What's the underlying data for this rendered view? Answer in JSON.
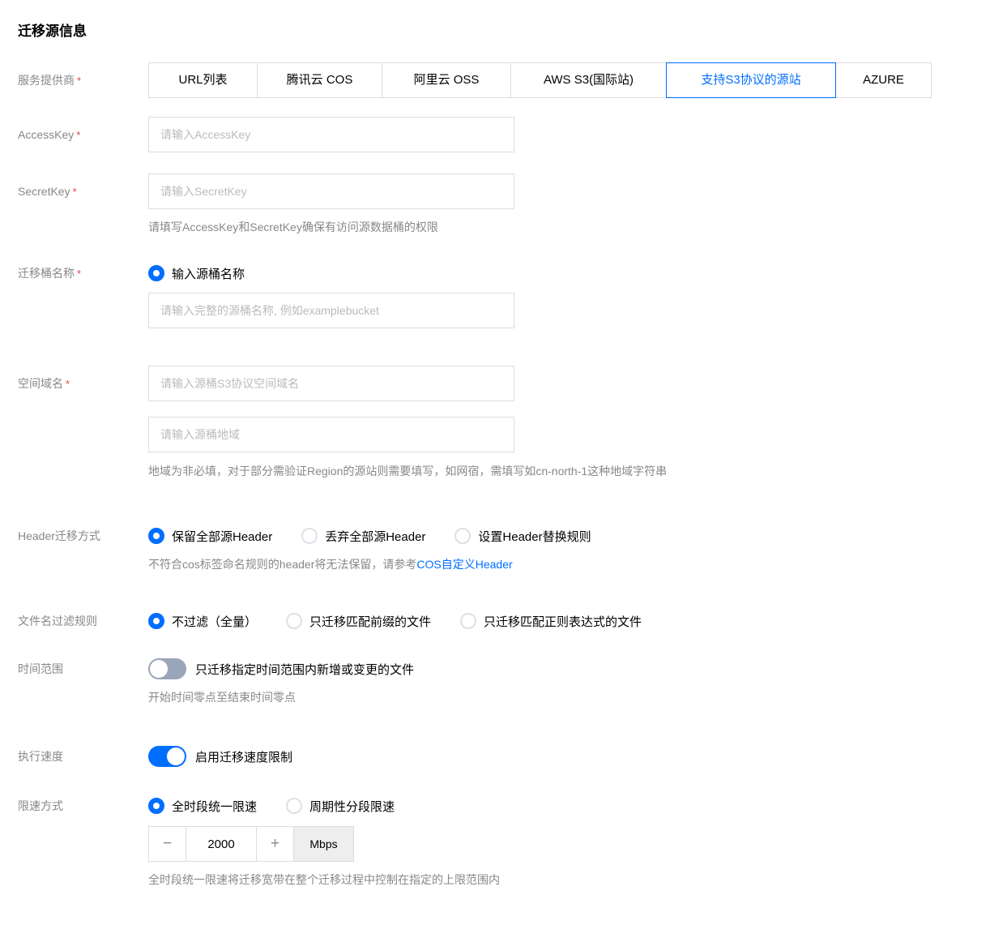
{
  "page": {
    "title": "迁移源信息",
    "required_mark": "*"
  },
  "colors": {
    "accent": "#006eff",
    "required": "#e54545",
    "toggle_off": "#9aa5ba",
    "border": "#dddddd"
  },
  "provider": {
    "label": "服务提供商",
    "tabs": [
      {
        "label": "URL列表",
        "selected": false
      },
      {
        "label": "腾讯云 COS",
        "selected": false
      },
      {
        "label": "阿里云 OSS",
        "selected": false
      },
      {
        "label": "AWS S3(国际站)",
        "selected": false
      },
      {
        "label": "支持S3协议的源站",
        "selected": true
      },
      {
        "label": "AZURE",
        "selected": false
      }
    ]
  },
  "access_key": {
    "label": "AccessKey",
    "value": "",
    "placeholder": "请输入AccessKey"
  },
  "secret_key": {
    "label": "SecretKey",
    "value": "",
    "placeholder": "请输入SecretKey",
    "help": "请填写AccessKey和SecretKey确保有访问源数据桶的权限"
  },
  "bucket_name": {
    "label": "迁移桶名称",
    "radio": {
      "label": "输入源桶名称",
      "selected": true
    },
    "value": "",
    "placeholder": "请输入完整的源桶名称, 例如examplebucket"
  },
  "domain": {
    "label": "空间域名",
    "value1": "",
    "placeholder1": "请输入源桶S3协议空间域名",
    "value2": "",
    "placeholder2": "请输入源桶地域",
    "help": "地域为非必填，对于部分需验证Region的源站则需要填写，如网宿，需填写如cn-north-1这种地域字符串"
  },
  "header_mode": {
    "label": "Header迁移方式",
    "options": [
      {
        "label": "保留全部源Header",
        "selected": true
      },
      {
        "label": "丢弃全部源Header",
        "selected": false
      },
      {
        "label": "设置Header替换规则",
        "selected": false
      }
    ],
    "help_prefix": "不符合cos标签命名规则的header将无法保留，请参考",
    "help_link": "COS自定义Header"
  },
  "filename_filter": {
    "label": "文件名过滤规则",
    "options": [
      {
        "label": "不过滤（全量）",
        "selected": true
      },
      {
        "label": "只迁移匹配前缀的文件",
        "selected": false
      },
      {
        "label": "只迁移匹配正则表达式的文件",
        "selected": false
      }
    ]
  },
  "time_range": {
    "label": "时间范围",
    "toggle": {
      "label": "只迁移指定时间范围内新增或变更的文件",
      "on": false
    },
    "help": "开始时间零点至结束时间零点"
  },
  "speed": {
    "label": "执行速度",
    "toggle": {
      "label": "启用迁移速度限制",
      "on": true
    }
  },
  "speed_limit": {
    "label": "限速方式",
    "options": [
      {
        "label": "全时段统一限速",
        "selected": true
      },
      {
        "label": "周期性分段限速",
        "selected": false
      }
    ],
    "stepper": {
      "minus": "−",
      "value": "2000",
      "plus": "+",
      "unit": "Mbps"
    },
    "help": "全时段统一限速将迁移宽带在整个迁移过程中控制在指定的上限范围内"
  }
}
